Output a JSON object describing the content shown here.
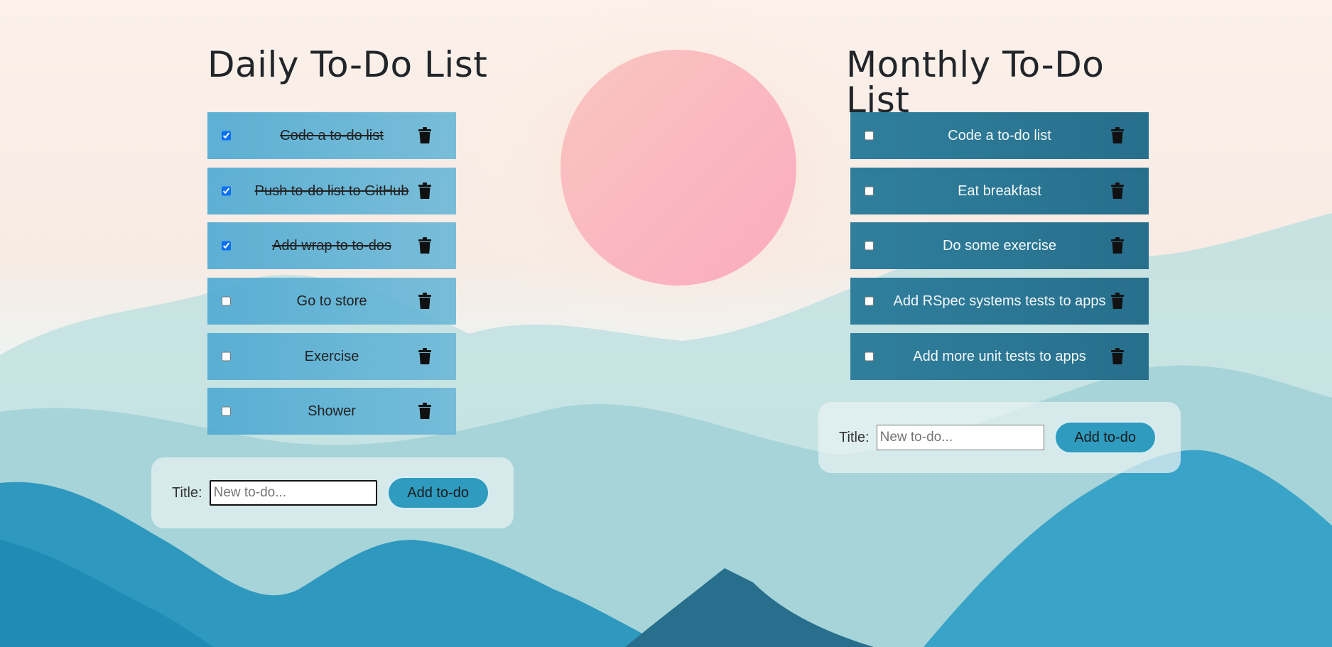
{
  "daily": {
    "title": "Daily To-Do List",
    "todos": [
      {
        "label": "Code a to-do list",
        "checked": true
      },
      {
        "label": "Push to-do list to GitHub",
        "checked": true
      },
      {
        "label": "Add wrap to to-dos",
        "checked": true
      },
      {
        "label": "Go to store",
        "checked": false
      },
      {
        "label": "Exercise",
        "checked": false
      },
      {
        "label": "Shower",
        "checked": false
      }
    ],
    "form": {
      "label": "Title:",
      "placeholder": "New to-do...",
      "button": "Add to-do"
    }
  },
  "monthly": {
    "title": "Monthly To-Do List",
    "todos": [
      {
        "label": "Code a to-do list",
        "checked": false
      },
      {
        "label": "Eat breakfast",
        "checked": false
      },
      {
        "label": "Do some exercise",
        "checked": false
      },
      {
        "label": "Add RSpec systems tests to apps",
        "checked": false
      },
      {
        "label": "Add more unit tests to apps",
        "checked": false
      }
    ],
    "form": {
      "label": "Title:",
      "placeholder": "New to-do...",
      "button": "Add to-do"
    }
  },
  "icons": {
    "delete": "trash-icon"
  },
  "colors": {
    "accent": "#2f9bbf",
    "daily_item": "#5aaed3",
    "monthly_item": "#2b7894"
  }
}
